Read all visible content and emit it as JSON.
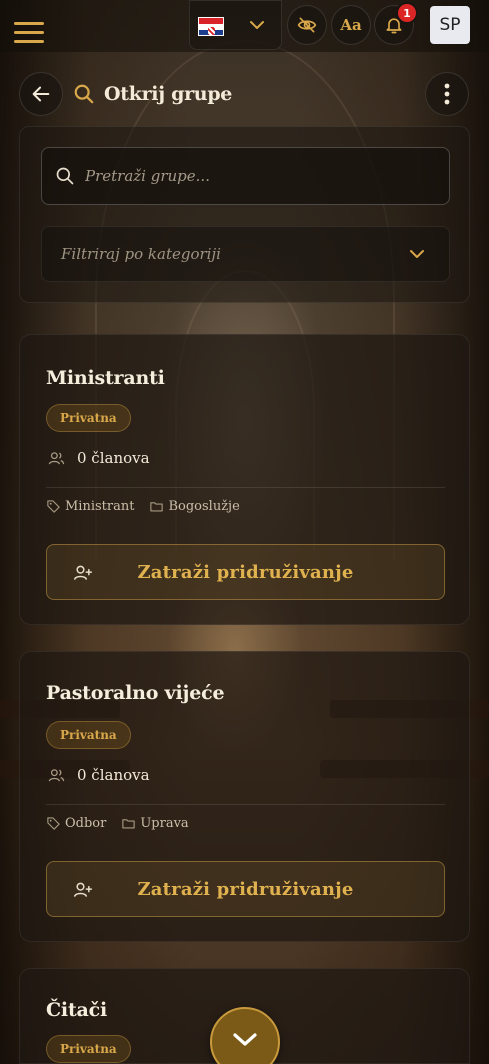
{
  "topbar": {
    "language_flag": "croatian-flag",
    "font_size_label": "Aa",
    "notification_count": "1",
    "user_initials": "SP"
  },
  "header": {
    "title": "Otkrij grupe"
  },
  "filters": {
    "search_placeholder": "Pretraži grupe...",
    "category_placeholder": "Filtriraj po kategoriji"
  },
  "groups": [
    {
      "name": "Ministranti",
      "privacy": "Privatna",
      "members": "0 članova",
      "tags": [
        "Ministrant",
        "Bogoslužje"
      ],
      "join_label": "Zatraži pridruživanje"
    },
    {
      "name": "Pastoralno vijeće",
      "privacy": "Privatna",
      "members": "0 članova",
      "tags": [
        "Odbor",
        "Uprava"
      ],
      "join_label": "Zatraži pridruživanje"
    },
    {
      "name": "Čitači",
      "privacy": "Privatna"
    }
  ],
  "colors": {
    "accent": "#d9a84a",
    "notification": "#dc2626"
  }
}
